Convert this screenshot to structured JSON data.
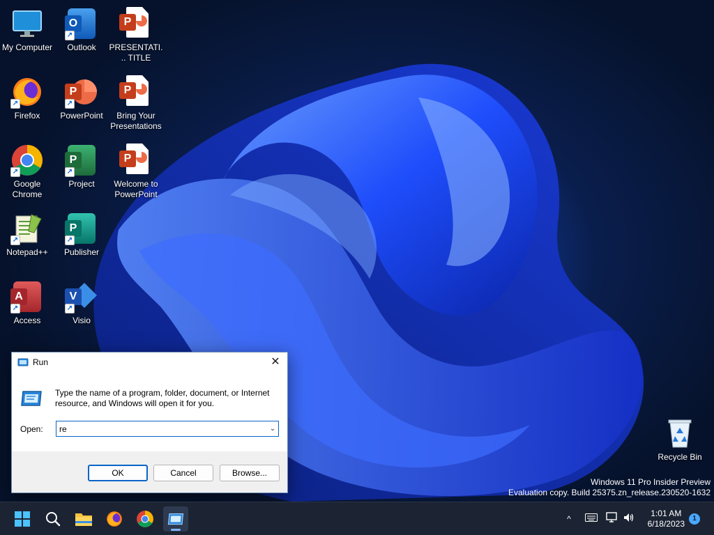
{
  "desktop": {
    "icons": [
      {
        "label": "My Computer",
        "icon": "monitor-icon"
      },
      {
        "label": "Outlook",
        "icon": "outlook-icon"
      },
      {
        "label": "PRESENTATI... TITLE",
        "icon": "powerpoint-file-icon"
      },
      {
        "label": "Firefox",
        "icon": "firefox-icon"
      },
      {
        "label": "PowerPoint",
        "icon": "powerpoint-icon"
      },
      {
        "label": "Bring Your Presentations",
        "icon": "powerpoint-file-icon"
      },
      {
        "label": "Google Chrome",
        "icon": "chrome-icon"
      },
      {
        "label": "Project",
        "icon": "project-icon"
      },
      {
        "label": "Welcome to PowerPoint",
        "icon": "powerpoint-file-icon"
      },
      {
        "label": "Notepad++",
        "icon": "notepadpp-icon"
      },
      {
        "label": "Publisher",
        "icon": "publisher-icon"
      },
      {
        "label": "Access",
        "icon": "access-icon"
      },
      {
        "label": "Visio",
        "icon": "visio-icon"
      },
      {
        "label": "Recycle Bin",
        "icon": "recycle-bin-icon"
      }
    ],
    "watermark": {
      "line1": "Windows 11 Pro Insider Preview",
      "line2": "Evaluation copy. Build 25375.zn_release.230520-1632"
    }
  },
  "run_dialog": {
    "title": "Run",
    "description": "Type the name of a program, folder, document, or Internet resource, and Windows will open it for you.",
    "open_label": "Open:",
    "input_value": "re",
    "ok_label": "OK",
    "cancel_label": "Cancel",
    "browse_label": "Browse...",
    "close_glyph": "✕"
  },
  "taskbar": {
    "apps": [
      "start-icon",
      "search-icon",
      "file-explorer-icon",
      "firefox-icon",
      "chrome-icon",
      "run-icon"
    ],
    "active_app": "run-icon",
    "tray": {
      "chevron": "^",
      "time": "1:01 AM",
      "date": "6/18/2023",
      "notification_count": "1"
    }
  },
  "colors": {
    "accent": "#0a64c8",
    "taskbar": "#1c2433",
    "wallpaper_blue": "#1a4fff"
  }
}
